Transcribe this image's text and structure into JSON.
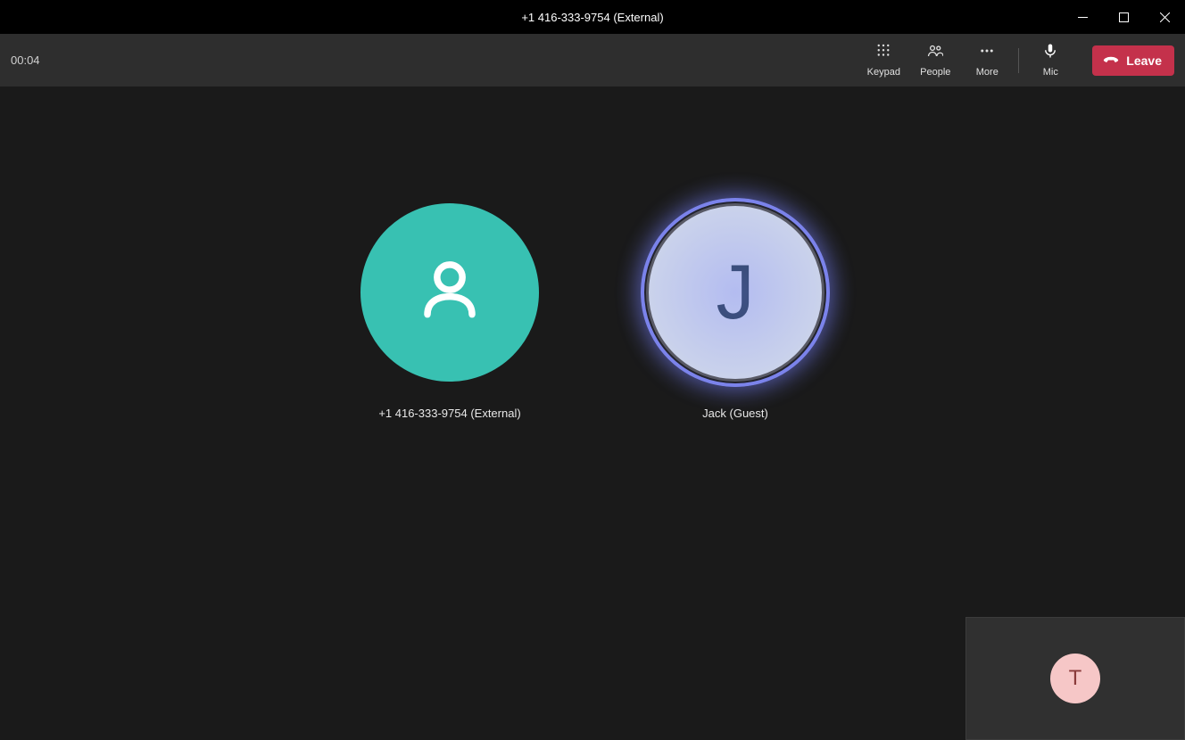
{
  "window": {
    "title": "+1 416-333-9754 (External)"
  },
  "toolbar": {
    "timer": "00:04",
    "keypad_label": "Keypad",
    "people_label": "People",
    "more_label": "More",
    "mic_label": "Mic",
    "leave_label": "Leave"
  },
  "participants": [
    {
      "name": "+1 416-333-9754 (External)",
      "initial": ""
    },
    {
      "name": "Jack (Guest)",
      "initial": "J"
    }
  ],
  "self": {
    "initial": "T"
  },
  "colors": {
    "external_avatar": "#38c1b2",
    "speaking_ring": "#7b83eb",
    "leave_button": "#c4314b",
    "self_avatar_bg": "#f6c7c7"
  }
}
